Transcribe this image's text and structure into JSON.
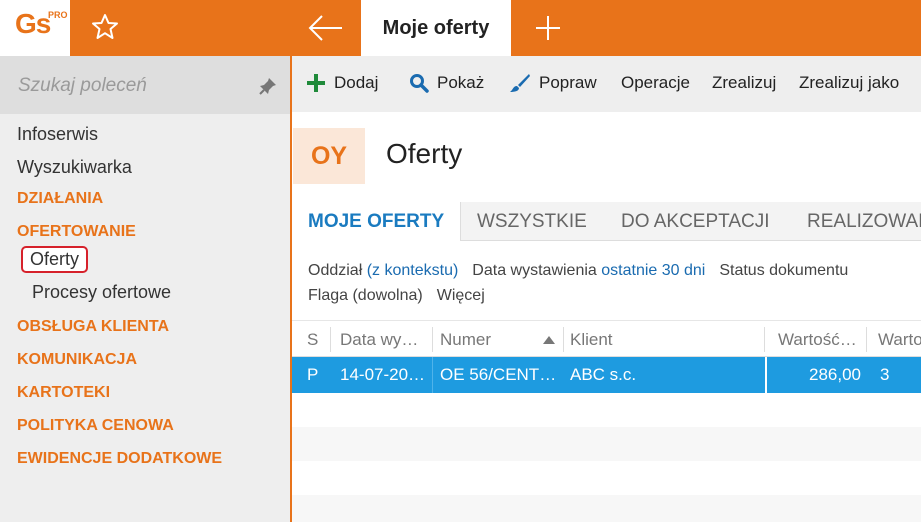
{
  "app": {
    "logo_text": "Gs",
    "logo_badge": "PRO",
    "active_tab": "Moje oferty"
  },
  "colors": {
    "accent": "#e8731a",
    "link": "#1a6bb0",
    "selection": "#1e9be0",
    "highlight_border": "#d6212b"
  },
  "icons": {
    "favorite": "star-outline-icon",
    "back": "arrow-left-icon",
    "new_tab": "plus-icon",
    "pin": "pin-icon"
  },
  "sidebar": {
    "search_placeholder": "Szukaj poleceń",
    "items": [
      {
        "label": "Infoserwis",
        "kind": "plain"
      },
      {
        "label": "Wyszukiwarka",
        "kind": "plain"
      },
      {
        "label": "DZIAŁANIA",
        "kind": "section"
      },
      {
        "label": "OFERTOWANIE",
        "kind": "section"
      },
      {
        "label": "Oferty",
        "kind": "sub",
        "selected": true
      },
      {
        "label": "Procesy ofertowe",
        "kind": "sub"
      },
      {
        "label": "OBSŁUGA KLIENTA",
        "kind": "section"
      },
      {
        "label": "KOMUNIKACJA",
        "kind": "section"
      },
      {
        "label": "KARTOTEKI",
        "kind": "section"
      },
      {
        "label": "POLITYKA CENOWA",
        "kind": "section"
      },
      {
        "label": "EWIDENCJE DODATKOWE",
        "kind": "section"
      }
    ]
  },
  "toolbar": {
    "add": "Dodaj",
    "show": "Pokaż",
    "edit": "Popraw",
    "operations": "Operacje",
    "realize": "Zrealizuj",
    "realize_as": "Zrealizuj jako"
  },
  "document": {
    "badge": "OY",
    "title": "Oferty"
  },
  "tabs": [
    "MOJE OFERTY",
    "WSZYSTKIE",
    "DO AKCEPTACJI",
    "REALIZOWANE"
  ],
  "filters": {
    "branch_label": "Oddział",
    "branch_value": "(z kontekstu)",
    "date_label": "Data wystawienia",
    "date_value": "ostatnie 30 dni",
    "status_label": "Status dokumentu",
    "flag_label": "Flaga (dowolna)",
    "more_label": "Więcej"
  },
  "grid": {
    "columns": [
      "S",
      "Data wy…",
      "Numer",
      "Klient",
      "Wartość…",
      "Warto"
    ],
    "sort_column": "Numer",
    "rows": [
      {
        "s": "P",
        "date": "14-07-20…",
        "number": "OE 56/CENT…",
        "client": "ABC s.c.",
        "value": "286,00",
        "value2": "3"
      }
    ]
  }
}
